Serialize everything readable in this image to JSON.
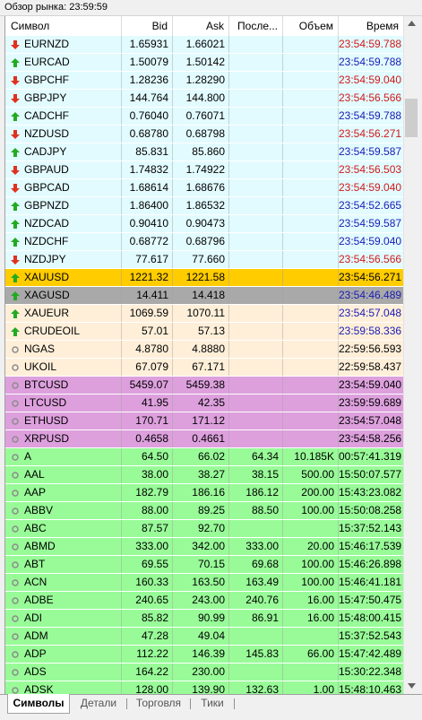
{
  "window": {
    "title": "Обзор рынка: 23:59:59"
  },
  "columns": [
    {
      "key": "symbol",
      "label": "Символ"
    },
    {
      "key": "bid",
      "label": "Bid"
    },
    {
      "key": "ask",
      "label": "Ask"
    },
    {
      "key": "last",
      "label": "Послe..."
    },
    {
      "key": "volume",
      "label": "Объем"
    },
    {
      "key": "time",
      "label": "Время"
    }
  ],
  "colors": {
    "forex": "#e2fbff",
    "metals": "#ffefd9",
    "gold_selected": "#ffcc00",
    "silver_selected": "#a9a9a9",
    "crypto": "#dda0dd",
    "stocks": "#98fb98",
    "time_up": "#1a1ab4",
    "time_down": "#d01a1a",
    "time_neutral": "#000000",
    "arrow_up": "#22aa22",
    "arrow_down": "#e0301e",
    "dot": "#8c8c8c"
  },
  "rows": [
    {
      "symbol": "EURNZD",
      "icon": "down",
      "bid": "1.65931",
      "ask": "1.66021",
      "last": "",
      "volume": "",
      "time": "23:54:59.788",
      "time_dir": "down",
      "group": "forex"
    },
    {
      "symbol": "EURCAD",
      "icon": "up",
      "bid": "1.50079",
      "ask": "1.50142",
      "last": "",
      "volume": "",
      "time": "23:54:59.788",
      "time_dir": "up",
      "group": "forex"
    },
    {
      "symbol": "GBPCHF",
      "icon": "down",
      "bid": "1.28236",
      "ask": "1.28290",
      "last": "",
      "volume": "",
      "time": "23:54:59.040",
      "time_dir": "down",
      "group": "forex"
    },
    {
      "symbol": "GBPJPY",
      "icon": "down",
      "bid": "144.764",
      "ask": "144.800",
      "last": "",
      "volume": "",
      "time": "23:54:56.566",
      "time_dir": "down",
      "group": "forex"
    },
    {
      "symbol": "CADCHF",
      "icon": "up",
      "bid": "0.76040",
      "ask": "0.76071",
      "last": "",
      "volume": "",
      "time": "23:54:59.788",
      "time_dir": "up",
      "group": "forex"
    },
    {
      "symbol": "NZDUSD",
      "icon": "down",
      "bid": "0.68780",
      "ask": "0.68798",
      "last": "",
      "volume": "",
      "time": "23:54:56.271",
      "time_dir": "down",
      "group": "forex"
    },
    {
      "symbol": "CADJPY",
      "icon": "up",
      "bid": "85.831",
      "ask": "85.860",
      "last": "",
      "volume": "",
      "time": "23:54:59.587",
      "time_dir": "up",
      "group": "forex"
    },
    {
      "symbol": "GBPAUD",
      "icon": "down",
      "bid": "1.74832",
      "ask": "1.74922",
      "last": "",
      "volume": "",
      "time": "23:54:56.503",
      "time_dir": "down",
      "group": "forex"
    },
    {
      "symbol": "GBPCAD",
      "icon": "down",
      "bid": "1.68614",
      "ask": "1.68676",
      "last": "",
      "volume": "",
      "time": "23:54:59.040",
      "time_dir": "down",
      "group": "forex"
    },
    {
      "symbol": "GBPNZD",
      "icon": "up",
      "bid": "1.86400",
      "ask": "1.86532",
      "last": "",
      "volume": "",
      "time": "23:54:52.665",
      "time_dir": "up",
      "group": "forex"
    },
    {
      "symbol": "NZDCAD",
      "icon": "up",
      "bid": "0.90410",
      "ask": "0.90473",
      "last": "",
      "volume": "",
      "time": "23:54:59.587",
      "time_dir": "up",
      "group": "forex"
    },
    {
      "symbol": "NZDCHF",
      "icon": "up",
      "bid": "0.68772",
      "ask": "0.68796",
      "last": "",
      "volume": "",
      "time": "23:54:59.040",
      "time_dir": "up",
      "group": "forex"
    },
    {
      "symbol": "NZDJPY",
      "icon": "down",
      "bid": "77.617",
      "ask": "77.660",
      "last": "",
      "volume": "",
      "time": "23:54:56.566",
      "time_dir": "down",
      "group": "forex"
    },
    {
      "symbol": "XAUUSD",
      "icon": "up",
      "bid": "1221.32",
      "ask": "1221.58",
      "last": "",
      "volume": "",
      "time": "23:54:56.271",
      "time_dir": "neutral",
      "group": "gold_selected"
    },
    {
      "symbol": "XAGUSD",
      "icon": "up",
      "bid": "14.411",
      "ask": "14.418",
      "last": "",
      "volume": "",
      "time": "23:54:46.489",
      "time_dir": "up",
      "group": "silver_selected"
    },
    {
      "symbol": "XAUEUR",
      "icon": "up",
      "bid": "1069.59",
      "ask": "1070.11",
      "last": "",
      "volume": "",
      "time": "23:54:57.048",
      "time_dir": "up",
      "group": "metals"
    },
    {
      "symbol": "CRUDEOIL",
      "icon": "up",
      "bid": "57.01",
      "ask": "57.13",
      "last": "",
      "volume": "",
      "time": "23:59:58.336",
      "time_dir": "up",
      "group": "metals"
    },
    {
      "symbol": "NGAS",
      "icon": "dot",
      "bid": "4.8780",
      "ask": "4.8880",
      "last": "",
      "volume": "",
      "time": "22:59:56.593",
      "time_dir": "neutral",
      "group": "metals"
    },
    {
      "symbol": "UKOIL",
      "icon": "dot",
      "bid": "67.079",
      "ask": "67.171",
      "last": "",
      "volume": "",
      "time": "22:59:58.437",
      "time_dir": "neutral",
      "group": "metals"
    },
    {
      "symbol": "BTCUSD",
      "icon": "dot",
      "bid": "5459.07",
      "ask": "5459.38",
      "last": "",
      "volume": "",
      "time": "23:54:59.040",
      "time_dir": "neutral",
      "group": "crypto"
    },
    {
      "symbol": "LTCUSD",
      "icon": "dot",
      "bid": "41.95",
      "ask": "42.35",
      "last": "",
      "volume": "",
      "time": "23:59:59.689",
      "time_dir": "neutral",
      "group": "crypto"
    },
    {
      "symbol": "ETHUSD",
      "icon": "dot",
      "bid": "170.71",
      "ask": "171.12",
      "last": "",
      "volume": "",
      "time": "23:54:57.048",
      "time_dir": "neutral",
      "group": "crypto"
    },
    {
      "symbol": "XRPUSD",
      "icon": "dot",
      "bid": "0.4658",
      "ask": "0.4661",
      "last": "",
      "volume": "",
      "time": "23:54:58.256",
      "time_dir": "neutral",
      "group": "crypto"
    },
    {
      "symbol": "A",
      "icon": "dot",
      "bid": "64.50",
      "ask": "66.02",
      "last": "64.34",
      "volume": "10.185K",
      "time": "00:57:41.319",
      "time_dir": "neutral",
      "group": "stocks"
    },
    {
      "symbol": "AAL",
      "icon": "dot",
      "bid": "38.00",
      "ask": "38.27",
      "last": "38.15",
      "volume": "500.00",
      "time": "15:50:07.577",
      "time_dir": "neutral",
      "group": "stocks"
    },
    {
      "symbol": "AAP",
      "icon": "dot",
      "bid": "182.79",
      "ask": "186.16",
      "last": "186.12",
      "volume": "200.00",
      "time": "15:43:23.082",
      "time_dir": "neutral",
      "group": "stocks"
    },
    {
      "symbol": "ABBV",
      "icon": "dot",
      "bid": "88.00",
      "ask": "89.25",
      "last": "88.50",
      "volume": "100.00",
      "time": "15:50:08.258",
      "time_dir": "neutral",
      "group": "stocks"
    },
    {
      "symbol": "ABC",
      "icon": "dot",
      "bid": "87.57",
      "ask": "92.70",
      "last": "",
      "volume": "",
      "time": "15:37:52.143",
      "time_dir": "neutral",
      "group": "stocks"
    },
    {
      "symbol": "ABMD",
      "icon": "dot",
      "bid": "333.00",
      "ask": "342.00",
      "last": "333.00",
      "volume": "20.00",
      "time": "15:46:17.539",
      "time_dir": "neutral",
      "group": "stocks"
    },
    {
      "symbol": "ABT",
      "icon": "dot",
      "bid": "69.55",
      "ask": "70.15",
      "last": "69.68",
      "volume": "100.00",
      "time": "15:46:26.898",
      "time_dir": "neutral",
      "group": "stocks"
    },
    {
      "symbol": "ACN",
      "icon": "dot",
      "bid": "160.33",
      "ask": "163.50",
      "last": "163.49",
      "volume": "100.00",
      "time": "15:46:41.181",
      "time_dir": "neutral",
      "group": "stocks"
    },
    {
      "symbol": "ADBE",
      "icon": "dot",
      "bid": "240.65",
      "ask": "243.00",
      "last": "240.76",
      "volume": "16.00",
      "time": "15:47:50.475",
      "time_dir": "neutral",
      "group": "stocks"
    },
    {
      "symbol": "ADI",
      "icon": "dot",
      "bid": "85.82",
      "ask": "90.99",
      "last": "86.91",
      "volume": "16.00",
      "time": "15:48:00.415",
      "time_dir": "neutral",
      "group": "stocks"
    },
    {
      "symbol": "ADM",
      "icon": "dot",
      "bid": "47.28",
      "ask": "49.04",
      "last": "",
      "volume": "",
      "time": "15:37:52.543",
      "time_dir": "neutral",
      "group": "stocks"
    },
    {
      "symbol": "ADP",
      "icon": "dot",
      "bid": "112.22",
      "ask": "146.39",
      "last": "145.83",
      "volume": "66.00",
      "time": "15:47:42.489",
      "time_dir": "neutral",
      "group": "stocks"
    },
    {
      "symbol": "ADS",
      "icon": "dot",
      "bid": "164.22",
      "ask": "230.00",
      "last": "",
      "volume": "",
      "time": "15:30:22.348",
      "time_dir": "neutral",
      "group": "stocks"
    },
    {
      "symbol": "ADSK",
      "icon": "dot",
      "bid": "128.00",
      "ask": "139.90",
      "last": "132.63",
      "volume": "1.00",
      "time": "15:48:10.463",
      "time_dir": "neutral",
      "group": "stocks"
    }
  ],
  "scrollbar": {
    "position": 0.11,
    "visible_fraction": 0.06
  },
  "tabs": [
    {
      "label": "Символы",
      "active": true
    },
    {
      "label": "Детали",
      "active": false
    },
    {
      "label": "Торговля",
      "active": false
    },
    {
      "label": "Тики",
      "active": false
    }
  ]
}
